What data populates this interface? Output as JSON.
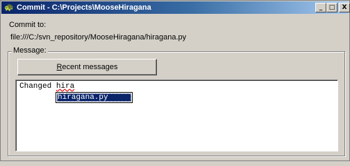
{
  "window": {
    "title": "Commit - C:\\Projects\\MooseHiragana",
    "icon": "tortoise-icon",
    "controls": {
      "minimize": "_",
      "maximize": "□",
      "close": "X"
    }
  },
  "commit": {
    "label": "Commit to:",
    "path": "file:///C:/svn_repository/MooseHiragana/hiragana.py"
  },
  "message": {
    "group_label": "Message:",
    "recent_button": {
      "accesskey": "R",
      "rest": "ecent messages"
    },
    "text_prefix": "Changed ",
    "text_word": "hira",
    "autocomplete_items": [
      "hiragana.py"
    ]
  },
  "colors": {
    "titlebar_start": "#0a246a",
    "titlebar_end": "#a6caf0",
    "selection": "#0a246a",
    "face": "#d4d0c8"
  }
}
